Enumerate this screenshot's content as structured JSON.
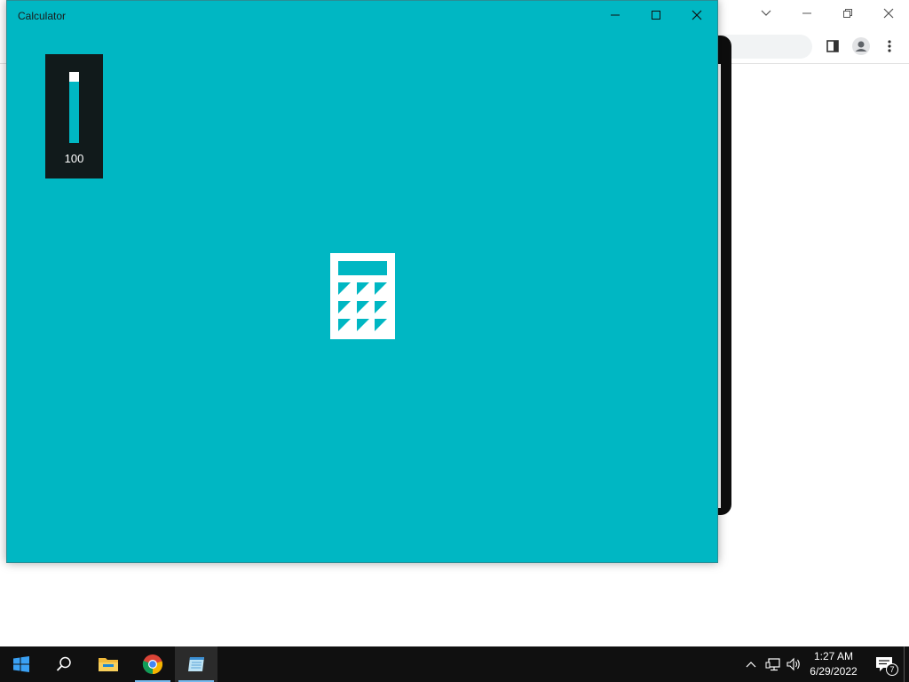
{
  "calculator": {
    "title": "Calculator",
    "accent_color": "#00b7c3",
    "volume_indicator": {
      "value_label": "100",
      "level_fraction": 1.0
    },
    "splash_icon": "calculator-icon"
  },
  "background_browser": {
    "name": "Google Chrome",
    "icons": [
      "chevron-down-icon",
      "minimize-icon",
      "restore-icon",
      "close-icon",
      "side-panel-icon",
      "profile-icon",
      "more-menu-icon"
    ]
  },
  "taskbar": {
    "pinned": [
      {
        "name": "start",
        "icon": "windows-logo-icon"
      },
      {
        "name": "search",
        "icon": "search-icon"
      },
      {
        "name": "file-explorer",
        "icon": "folder-icon"
      },
      {
        "name": "chrome",
        "icon": "chrome-icon",
        "running": true
      },
      {
        "name": "calculator",
        "icon": "notepad-icon",
        "running": true,
        "active": true
      }
    ],
    "tray": {
      "icons": [
        "show-hidden-icons-chevron",
        "network-icon",
        "volume-icon"
      ],
      "time": "1:27 AM",
      "date": "6/29/2022",
      "notification_count": "7"
    }
  }
}
